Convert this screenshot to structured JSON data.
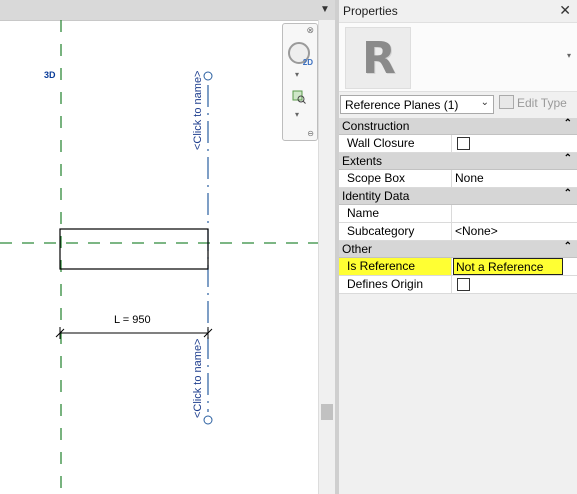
{
  "canvas": {
    "view_icon_label": "3D",
    "dimension_label": "L = 950",
    "ref_plane_top_label": "<Click to name>",
    "ref_plane_bottom_label": "<Click to name>",
    "navbar": {
      "close": "⊗",
      "wheel_badge": "2D",
      "arrow": "▾",
      "bottom": "⊖"
    },
    "menu_glyph": "▼"
  },
  "properties": {
    "title": "Properties",
    "close_label": "✕",
    "type_icon_letter": "R",
    "type_dropdown_glyph": "▾",
    "category_selector": "Reference Planes (1)",
    "edit_type_label": "Edit Type",
    "collapse_glyph": "⌃",
    "sections": [
      {
        "name": "Construction",
        "rows": [
          {
            "name": "Wall Closure",
            "value": "",
            "checkbox": true
          }
        ]
      },
      {
        "name": "Extents",
        "rows": [
          {
            "name": "Scope Box",
            "value": "None"
          }
        ]
      },
      {
        "name": "Identity Data",
        "rows": [
          {
            "name": "Name",
            "value": ""
          },
          {
            "name": "Subcategory",
            "value": "<None>"
          }
        ]
      },
      {
        "name": "Other",
        "rows": [
          {
            "name": "Is Reference",
            "value": "Not a Reference",
            "highlight": true
          },
          {
            "name": "Defines Origin",
            "value": "",
            "checkbox": true
          }
        ]
      }
    ],
    "highlight_color": "#ffff33"
  },
  "colors": {
    "ref_plane_line": "#2a5fa0",
    "green_dash": "#2f8a3a"
  }
}
